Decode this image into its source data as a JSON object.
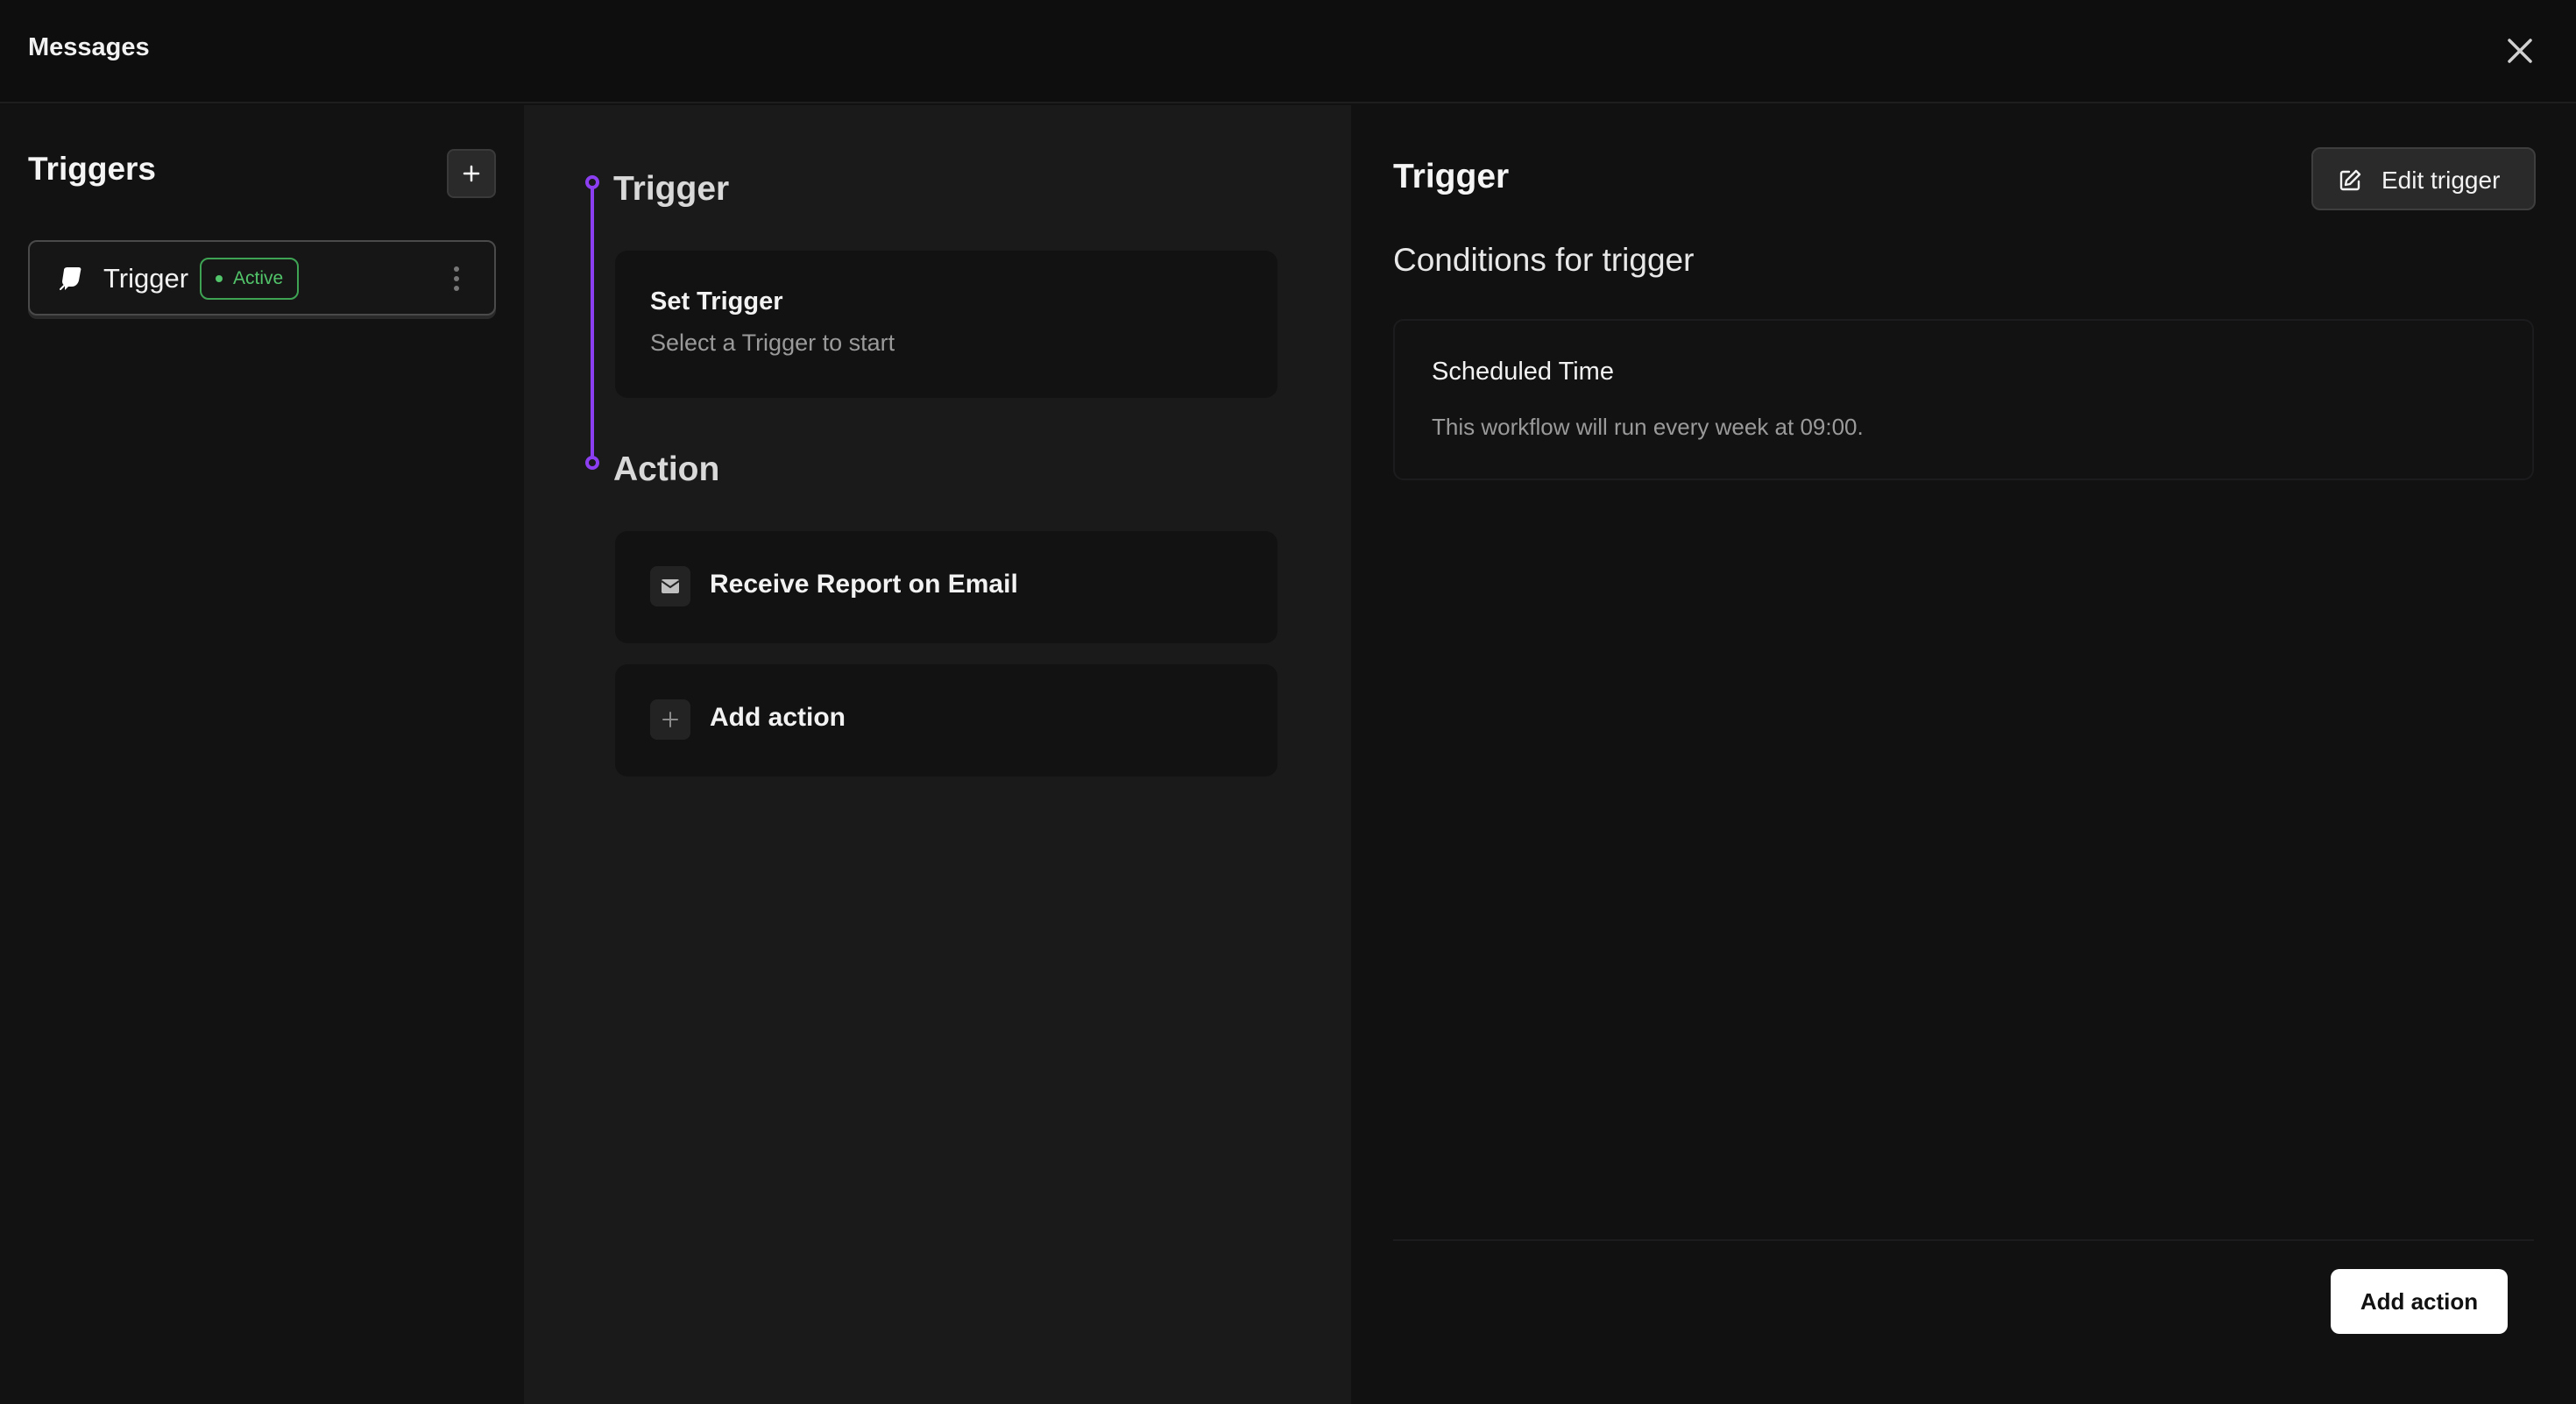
{
  "topbar": {
    "title": "Messages"
  },
  "sidebar": {
    "heading": "Triggers",
    "items": [
      {
        "label": "Trigger",
        "status": "Active"
      }
    ]
  },
  "canvas": {
    "trigger_section": "Trigger",
    "trigger_card": {
      "title": "Set Trigger",
      "subtitle": "Select a Trigger to start"
    },
    "action_section": "Action",
    "actions": [
      {
        "label": "Receive Report on Email",
        "icon": "mail-icon"
      }
    ],
    "add_action_label": "Add action"
  },
  "detail": {
    "title": "Trigger",
    "edit_label": "Edit trigger",
    "conditions_heading": "Conditions for trigger",
    "condition": {
      "title": "Scheduled Time",
      "description": "This workflow will run every week at 09:00."
    },
    "footer_button": "Add action"
  },
  "colors": {
    "accent": "#8b3ff0",
    "active": "#52c46a",
    "background": "#111111"
  }
}
